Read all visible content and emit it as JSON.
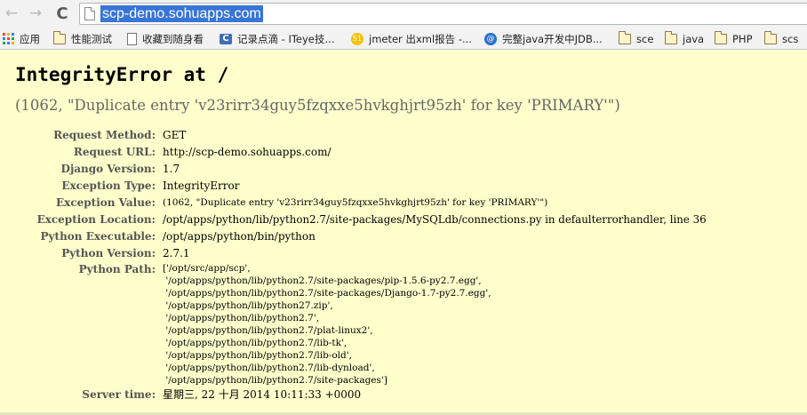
{
  "browser": {
    "nav": {
      "back": "←",
      "forward": "→",
      "reload": "C"
    },
    "url": "scp-demo.sohuapps.com",
    "bookmarks": [
      {
        "label": "应用",
        "icon": "apps-grid-icon"
      },
      {
        "label": "性能测试",
        "icon": "folder-icon"
      },
      {
        "label": "收藏到随身看",
        "icon": "page-icon"
      },
      {
        "label": "记录点滴 - ITeye技...",
        "icon": "c-logo-icon"
      },
      {
        "label": "jmeter 出xml报告 -...",
        "icon": "yellow-circle-icon"
      },
      {
        "label": "完整java开发中JDB...",
        "icon": "blue-circle-icon"
      },
      {
        "label": "sce",
        "icon": "folder-icon"
      },
      {
        "label": "java",
        "icon": "folder-icon"
      },
      {
        "label": "PHP",
        "icon": "folder-icon"
      },
      {
        "label": "scs",
        "icon": "folder-icon"
      }
    ]
  },
  "error": {
    "title": "IntegrityError at /",
    "value": "(1062, \"Duplicate entry 'v23rirr34guy5fzqxxe5hvkghjrt95zh' for key 'PRIMARY'\")",
    "meta": [
      {
        "label": "Request Method:",
        "value": "GET"
      },
      {
        "label": "Request URL:",
        "value": "http://scp-demo.sohuapps.com/"
      },
      {
        "label": "Django Version:",
        "value": "1.7"
      },
      {
        "label": "Exception Type:",
        "value": "IntegrityError"
      },
      {
        "label": "Exception Value:",
        "value": "(1062, \"Duplicate entry 'v23rirr34guy5fzqxxe5hvkghjrt95zh' for key 'PRIMARY'\")"
      },
      {
        "label": "Exception Location:",
        "value": "/opt/apps/python/lib/python2.7/site-packages/MySQLdb/connections.py in defaulterrorhandler, line 36"
      },
      {
        "label": "Python Executable:",
        "value": "/opt/apps/python/bin/python"
      },
      {
        "label": "Python Version:",
        "value": "2.7.1"
      }
    ],
    "python_path_label": "Python Path:",
    "python_path": [
      "['/opt/src/app/scp',",
      " '/opt/apps/python/lib/python2.7/site-packages/pip-1.5.6-py2.7.egg',",
      " '/opt/apps/python/lib/python2.7/site-packages/Django-1.7-py2.7.egg',",
      " '/opt/apps/python/lib/python27.zip',",
      " '/opt/apps/python/lib/python2.7',",
      " '/opt/apps/python/lib/python2.7/plat-linux2',",
      " '/opt/apps/python/lib/python2.7/lib-tk',",
      " '/opt/apps/python/lib/python2.7/lib-old',",
      " '/opt/apps/python/lib/python2.7/lib-dynload',",
      " '/opt/apps/python/lib/python2.7/site-packages']"
    ],
    "server_time_label": "Server time:",
    "server_time": "星期三, 22 十月 2014 10:11:33 +0000"
  }
}
